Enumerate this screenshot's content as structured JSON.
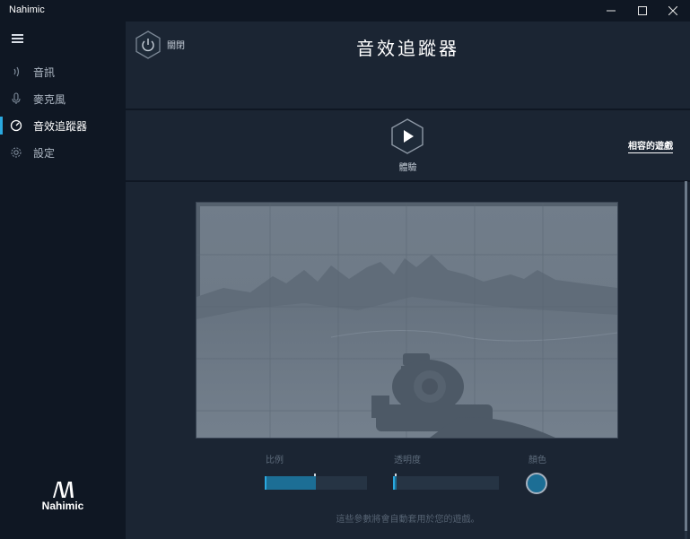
{
  "window": {
    "title": "Nahimic",
    "controls": {
      "minimize": "—",
      "maximize": "☐",
      "close": "✕"
    }
  },
  "sidebar": {
    "items": [
      {
        "label": "音訊",
        "icon": "audio-wave-icon",
        "active": false
      },
      {
        "label": "麥克風",
        "icon": "microphone-icon",
        "active": false
      },
      {
        "label": "音效追蹤器",
        "icon": "sound-tracker-icon",
        "active": true
      },
      {
        "label": "設定",
        "icon": "gear-icon",
        "active": false
      }
    ],
    "logo_text": "Nahimic"
  },
  "header": {
    "power_label": "關閉",
    "title": "音效追蹤器"
  },
  "demo": {
    "play_label": "體驗",
    "compat_link": "相容的遊戲"
  },
  "controls": {
    "scale_label": "比例",
    "scale_value": 0.5,
    "opacity_label": "透明度",
    "opacity_value": 0.0,
    "color_label": "顏色",
    "color_value": "#1c6e95"
  },
  "footer_note": "這些參數將會自動套用於您的遊戲。",
  "colors": {
    "accent": "#2aa9e0",
    "sidebar_bg": "#0f1723",
    "main_bg": "#1b2533"
  }
}
